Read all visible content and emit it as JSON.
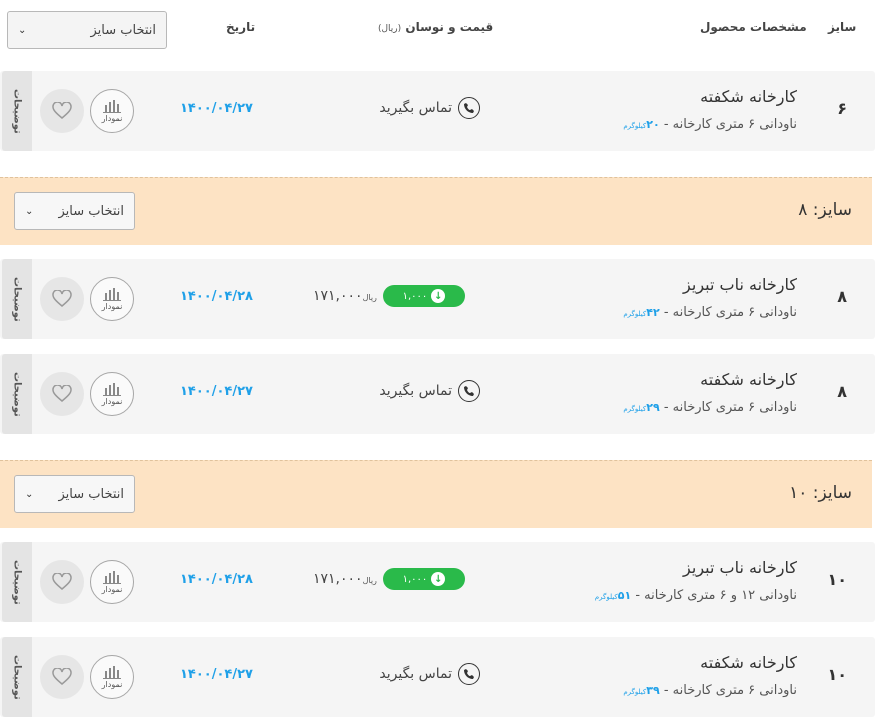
{
  "header": {
    "size": "سایز",
    "specs": "مشخصات محصول",
    "price": "قیمت و نوسان",
    "price_unit": "(ریال)",
    "date": "تاریخ",
    "select_size": "انتخاب سایز"
  },
  "common": {
    "desc_tab": "توضیحات",
    "chart_label": "نمودار",
    "call_label": "تماس بگیرید",
    "weight_unit": "کیلوگرم",
    "currency": "ریال",
    "group_prefix": "سایز:",
    "group_select": "انتخاب سایز"
  },
  "rows": [
    {
      "size": "۶",
      "name": "کارخانه شکفته",
      "spec": "ناودانی ۶ متری کارخانه -",
      "weight": "۲۰",
      "date": "۱۴۰۰/۰۴/۲۷",
      "has_price": false
    },
    {
      "size": "۸",
      "name": "کارخانه ناب تبریز",
      "spec": "ناودانی ۶ متری کارخانه -",
      "weight": "۴۲",
      "date": "۱۴۰۰/۰۴/۲۸",
      "has_price": true,
      "price": "۱۷۱,۰۰۰",
      "change": "۱,۰۰۰"
    },
    {
      "size": "۸",
      "name": "کارخانه شکفته",
      "spec": "ناودانی ۶ متری کارخانه -",
      "weight": "۲۹",
      "date": "۱۴۰۰/۰۴/۲۷",
      "has_price": false
    },
    {
      "size": "۱۰",
      "name": "کارخانه ناب تبریز",
      "spec": "ناودانی ۱۲ و ۶ متری کارخانه -",
      "weight": "۵۱",
      "date": "۱۴۰۰/۰۴/۲۸",
      "has_price": true,
      "price": "۱۷۱,۰۰۰",
      "change": "۱,۰۰۰"
    },
    {
      "size": "۱۰",
      "name": "کارخانه شکفته",
      "spec": "ناودانی ۶ متری کارخانه -",
      "weight": "۳۹",
      "date": "۱۴۰۰/۰۴/۲۷",
      "has_price": false
    }
  ],
  "groups": [
    {
      "size": "۸"
    },
    {
      "size": "۱۰"
    }
  ],
  "colors": {
    "accent": "#1fa0e8",
    "badge": "#2aba4a",
    "group_bg": "#fde3c4"
  }
}
